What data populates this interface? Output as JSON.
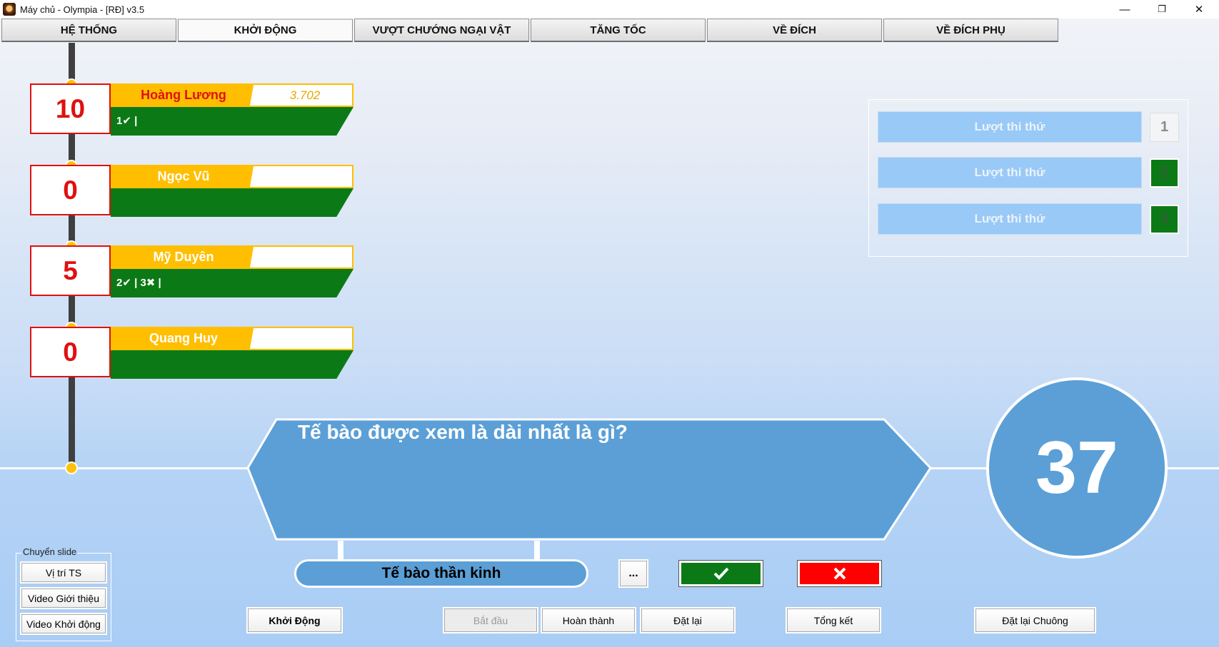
{
  "window": {
    "title": "Máy chủ - Olympia - [RĐ] v3.5",
    "icon": "olympia-app-icon"
  },
  "controls": {
    "minimize": "—",
    "restore": "❐",
    "close": "✕"
  },
  "tabs": [
    {
      "label": "HỆ THỐNG",
      "active": false
    },
    {
      "label": "KHỞI ĐỘNG",
      "active": true
    },
    {
      "label": "VƯỢT CHƯỚNG NGẠI VẬT",
      "active": false
    },
    {
      "label": "TĂNG TỐC",
      "active": false
    },
    {
      "label": "VỀ ĐÍCH",
      "active": false
    },
    {
      "label": "VỀ ĐÍCH PHỤ",
      "active": false
    }
  ],
  "players": [
    {
      "score": "10",
      "name": "Hoàng Lương",
      "time": "3.702",
      "history": "1✔ |",
      "highlighted": true
    },
    {
      "score": "0",
      "name": "Ngọc Vũ",
      "time": "",
      "history": ""
    },
    {
      "score": "5",
      "name": "Mỹ Duyên",
      "time": "",
      "history": "2✔ | 3✖ |"
    },
    {
      "score": "0",
      "name": "Quang Huy",
      "time": "",
      "history": ""
    }
  ],
  "turns": [
    {
      "label": "Lượt thi thứ",
      "number": "1",
      "state": "plain"
    },
    {
      "label": "Lượt thi thứ",
      "number": "2",
      "state": "green"
    },
    {
      "label": "Lượt thi thứ",
      "number": "3",
      "state": "green"
    }
  ],
  "question": {
    "text": "Tế bào được xem là dài nhất là gì?",
    "answer": "Tế bào thần kinh"
  },
  "timer": "37",
  "actions": {
    "more": "...",
    "correct_icon": "check-icon",
    "wrong_icon": "x-icon"
  },
  "slide": {
    "legend": "Chuyển slide",
    "buttons": [
      "Vị trí TS",
      "Video Giới thiệu",
      "Video Khởi động"
    ]
  },
  "bottom_buttons": {
    "start_round": "Khởi Động",
    "begin": "Bắt đầu",
    "finish": "Hoàn thành",
    "reset": "Đặt lại",
    "summary": "Tổng kết",
    "reset_bell": "Đặt lại Chuông"
  },
  "colors": {
    "gold": "#ffbf00",
    "green": "#0b7a16",
    "red": "#e01010",
    "blue": "#5b9fd6"
  }
}
